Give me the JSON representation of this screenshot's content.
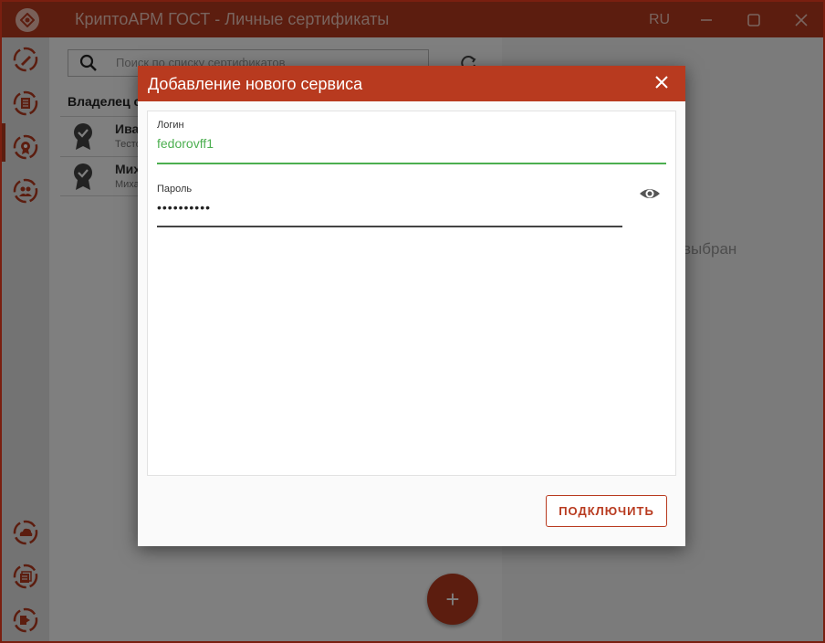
{
  "window": {
    "title": "КриптоАРМ ГОСТ - Личные сертификаты",
    "language": "RU"
  },
  "sidebar": {
    "items": [
      {
        "icon": "signature-icon"
      },
      {
        "icon": "document-icon"
      },
      {
        "icon": "certificate-icon",
        "active": true
      },
      {
        "icon": "contacts-icon"
      },
      {
        "icon": "cloud-icon"
      },
      {
        "icon": "log-icon"
      },
      {
        "icon": "exit-icon"
      }
    ]
  },
  "main": {
    "search_placeholder": "Поиск по списку сертификатов",
    "column_header": "Владелец се",
    "certificates": [
      {
        "name": "Ива",
        "subtitle": "Тесто"
      },
      {
        "name": "Мих",
        "subtitle": "Миха"
      }
    ],
    "not_selected_text": "выбран",
    "add_button_label": "+"
  },
  "dialog": {
    "title": "Добавление нового сервиса",
    "login_label": "Логин",
    "login_value": "fedorovff1",
    "password_label": "Пароль",
    "password_value": "••••••••••",
    "connect_label": "ПОДКЛЮЧИТЬ"
  },
  "colors": {
    "accent": "#b83a1f",
    "focus_green": "#4caf50"
  }
}
